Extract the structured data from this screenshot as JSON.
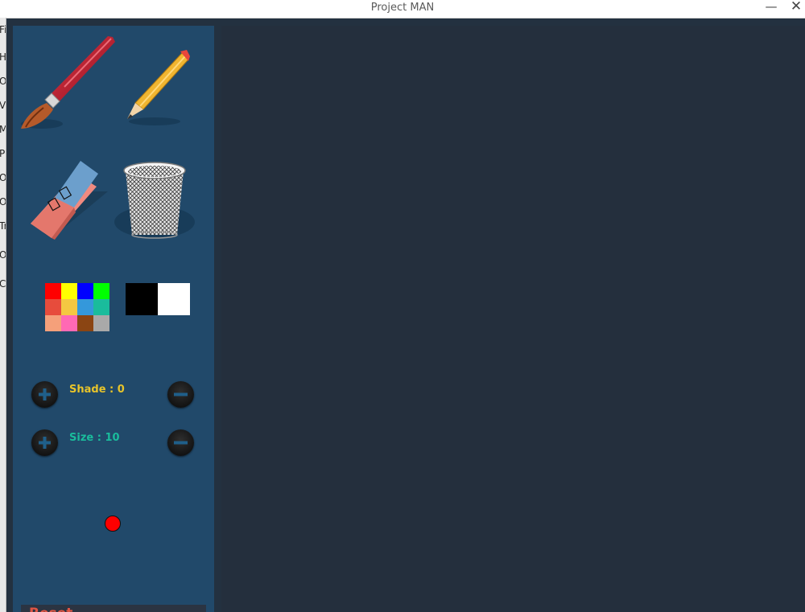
{
  "window": {
    "title": "Project MAN",
    "minimize_symbol": "—",
    "close_symbol": "✕"
  },
  "background_strip": {
    "chars": [
      "Fi",
      "H",
      "O",
      "Vi",
      "M",
      "Pi",
      "O",
      "O",
      "Tr",
      "O",
      "Co"
    ]
  },
  "tools": [
    {
      "name": "brush",
      "icon": "paintbrush-icon"
    },
    {
      "name": "pencil",
      "icon": "pencil-icon"
    },
    {
      "name": "eraser",
      "icon": "eraser-icon"
    },
    {
      "name": "clear",
      "icon": "trash-bin-icon"
    }
  ],
  "palette": {
    "colors": [
      "#ff0000",
      "#ffff00",
      "#0000ff",
      "#00ff00",
      "#e74c3c",
      "#f4c842",
      "#3498db",
      "#1abc9c",
      "#f5a07a",
      "#ff69b4",
      "#8b4513",
      "#a9a9a9"
    ],
    "black_white": [
      "#000000",
      "#ffffff"
    ]
  },
  "shade": {
    "label": "Shade : 0",
    "color": "#e8c42a"
  },
  "size": {
    "label": "Size : 10",
    "color": "#1abc9c"
  },
  "current_color": "#ff0000",
  "reset": {
    "label": "Reset",
    "color": "#e05544"
  }
}
